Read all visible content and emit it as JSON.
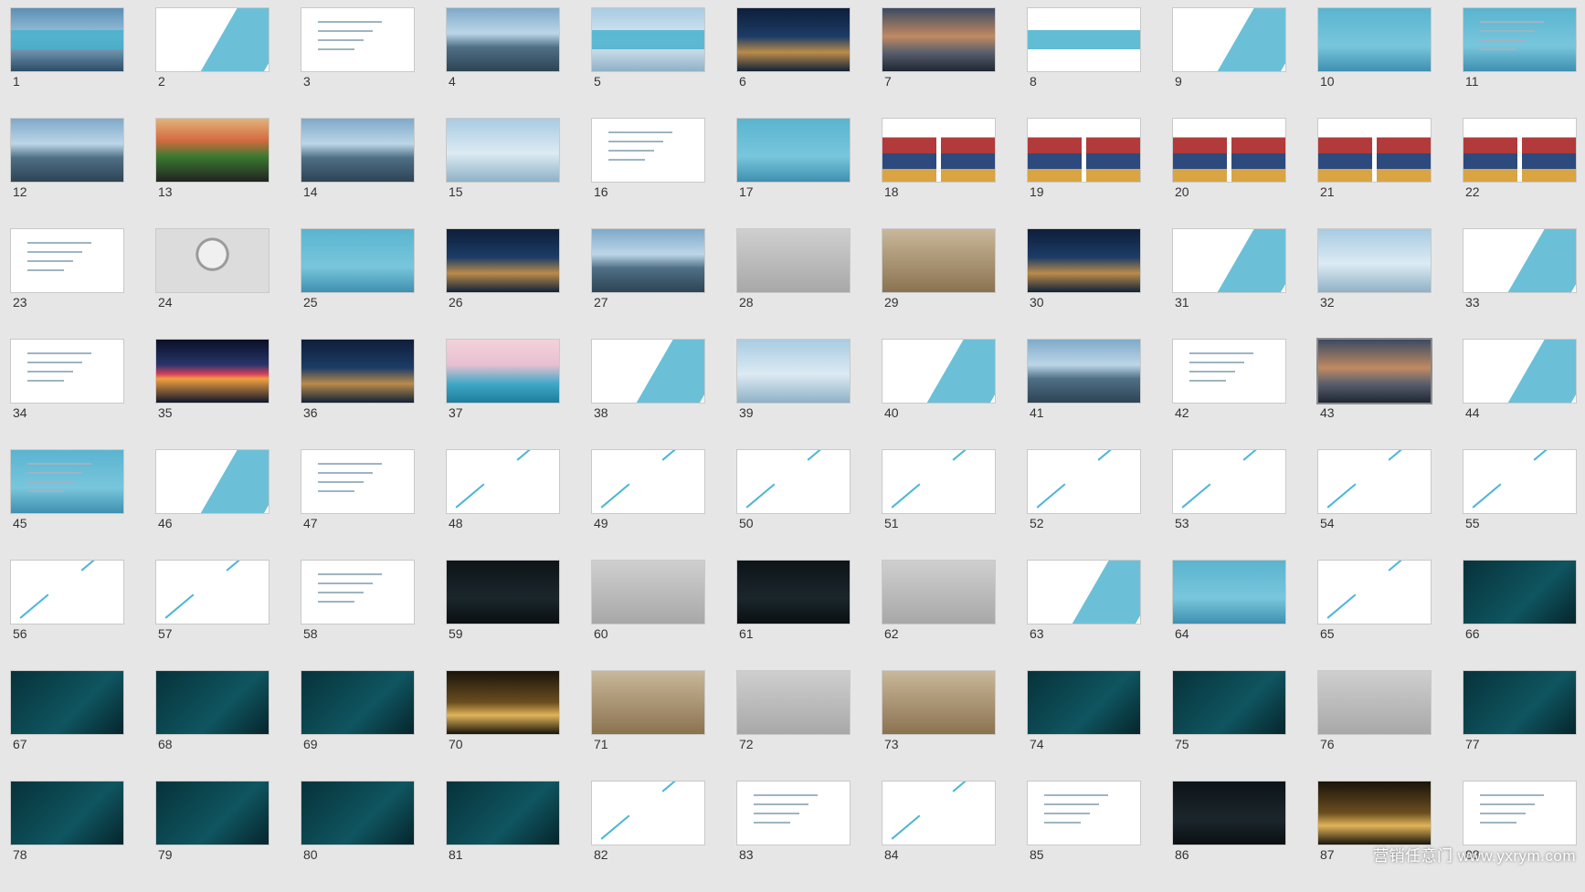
{
  "view": "slide-sorter",
  "accent_color": "#4bb6d6",
  "selected_slide": 43,
  "slides": [
    {
      "num": "1",
      "style": "photo-blue",
      "deco": "band"
    },
    {
      "num": "2",
      "style": "white",
      "deco": "diag"
    },
    {
      "num": "3",
      "style": "white",
      "deco": "lines"
    },
    {
      "num": "4",
      "style": "city",
      "deco": "none"
    },
    {
      "num": "5",
      "style": "sky",
      "deco": "band"
    },
    {
      "num": "6",
      "style": "night",
      "deco": "none"
    },
    {
      "num": "7",
      "style": "dusk",
      "deco": "none"
    },
    {
      "num": "8",
      "style": "white",
      "deco": "band"
    },
    {
      "num": "9",
      "style": "white",
      "deco": "diag"
    },
    {
      "num": "10",
      "style": "teal",
      "deco": "none"
    },
    {
      "num": "11",
      "style": "teal",
      "deco": "lines"
    },
    {
      "num": "12",
      "style": "city",
      "deco": "none"
    },
    {
      "num": "13",
      "style": "road",
      "deco": "none"
    },
    {
      "num": "14",
      "style": "city",
      "deco": "none"
    },
    {
      "num": "15",
      "style": "sky",
      "deco": "none"
    },
    {
      "num": "16",
      "style": "white",
      "deco": "lines"
    },
    {
      "num": "17",
      "style": "teal",
      "deco": "none"
    },
    {
      "num": "18",
      "style": "collage",
      "deco": "none"
    },
    {
      "num": "19",
      "style": "collage",
      "deco": "none"
    },
    {
      "num": "20",
      "style": "collage",
      "deco": "none"
    },
    {
      "num": "21",
      "style": "collage",
      "deco": "none"
    },
    {
      "num": "22",
      "style": "collage",
      "deco": "none"
    },
    {
      "num": "23",
      "style": "white",
      "deco": "lines"
    },
    {
      "num": "24",
      "style": "spheres",
      "deco": "none"
    },
    {
      "num": "25",
      "style": "teal",
      "deco": "none"
    },
    {
      "num": "26",
      "style": "night",
      "deco": "none"
    },
    {
      "num": "27",
      "style": "city",
      "deco": "none"
    },
    {
      "num": "28",
      "style": "gray",
      "deco": "none"
    },
    {
      "num": "29",
      "style": "wood",
      "deco": "none"
    },
    {
      "num": "30",
      "style": "night",
      "deco": "none"
    },
    {
      "num": "31",
      "style": "white",
      "deco": "diag"
    },
    {
      "num": "32",
      "style": "sky",
      "deco": "none"
    },
    {
      "num": "33",
      "style": "white",
      "deco": "diag"
    },
    {
      "num": "34",
      "style": "white",
      "deco": "lines"
    },
    {
      "num": "35",
      "style": "bridge",
      "deco": "none"
    },
    {
      "num": "36",
      "style": "night",
      "deco": "none"
    },
    {
      "num": "37",
      "style": "mountain",
      "deco": "none"
    },
    {
      "num": "38",
      "style": "white",
      "deco": "diag"
    },
    {
      "num": "39",
      "style": "sky",
      "deco": "none"
    },
    {
      "num": "40",
      "style": "white",
      "deco": "diag"
    },
    {
      "num": "41",
      "style": "city",
      "deco": "none"
    },
    {
      "num": "42",
      "style": "white",
      "deco": "lines"
    },
    {
      "num": "43",
      "style": "dusk",
      "deco": "none"
    },
    {
      "num": "44",
      "style": "white",
      "deco": "diag"
    },
    {
      "num": "45",
      "style": "teal",
      "deco": "lines"
    },
    {
      "num": "46",
      "style": "white",
      "deco": "diag"
    },
    {
      "num": "47",
      "style": "white",
      "deco": "lines"
    },
    {
      "num": "48",
      "style": "white",
      "deco": "diagline"
    },
    {
      "num": "49",
      "style": "white",
      "deco": "diagline"
    },
    {
      "num": "50",
      "style": "white",
      "deco": "diagline"
    },
    {
      "num": "51",
      "style": "white",
      "deco": "diagline"
    },
    {
      "num": "52",
      "style": "white",
      "deco": "diagline"
    },
    {
      "num": "53",
      "style": "white",
      "deco": "diagline"
    },
    {
      "num": "54",
      "style": "white",
      "deco": "diagline"
    },
    {
      "num": "55",
      "style": "white",
      "deco": "diagline"
    },
    {
      "num": "56",
      "style": "white",
      "deco": "diagline"
    },
    {
      "num": "57",
      "style": "white",
      "deco": "diagline"
    },
    {
      "num": "58",
      "style": "white",
      "deco": "lines"
    },
    {
      "num": "59",
      "style": "dark",
      "deco": "none"
    },
    {
      "num": "60",
      "style": "gray",
      "deco": "none"
    },
    {
      "num": "61",
      "style": "dark",
      "deco": "none"
    },
    {
      "num": "62",
      "style": "gray",
      "deco": "none"
    },
    {
      "num": "63",
      "style": "white",
      "deco": "diag"
    },
    {
      "num": "64",
      "style": "teal",
      "deco": "none"
    },
    {
      "num": "65",
      "style": "white",
      "deco": "diagline"
    },
    {
      "num": "66",
      "style": "darkteal",
      "deco": "none"
    },
    {
      "num": "67",
      "style": "darkteal",
      "deco": "none"
    },
    {
      "num": "68",
      "style": "darkteal",
      "deco": "none"
    },
    {
      "num": "69",
      "style": "darkteal",
      "deco": "none"
    },
    {
      "num": "70",
      "style": "gold",
      "deco": "none"
    },
    {
      "num": "71",
      "style": "wood",
      "deco": "none"
    },
    {
      "num": "72",
      "style": "gray",
      "deco": "none"
    },
    {
      "num": "73",
      "style": "wood",
      "deco": "none"
    },
    {
      "num": "74",
      "style": "darkteal",
      "deco": "none"
    },
    {
      "num": "75",
      "style": "darkteal",
      "deco": "none"
    },
    {
      "num": "76",
      "style": "gray",
      "deco": "none"
    },
    {
      "num": "77",
      "style": "darkteal",
      "deco": "none"
    },
    {
      "num": "78",
      "style": "darkteal",
      "deco": "none"
    },
    {
      "num": "79",
      "style": "darkteal",
      "deco": "none"
    },
    {
      "num": "80",
      "style": "darkteal",
      "deco": "none"
    },
    {
      "num": "81",
      "style": "darkteal",
      "deco": "none"
    },
    {
      "num": "82",
      "style": "white",
      "deco": "diagline"
    },
    {
      "num": "83",
      "style": "white",
      "deco": "lines"
    },
    {
      "num": "84",
      "style": "white",
      "deco": "diagline"
    },
    {
      "num": "85",
      "style": "white",
      "deco": "lines"
    },
    {
      "num": "86",
      "style": "dark",
      "deco": "none"
    },
    {
      "num": "87",
      "style": "gold",
      "deco": "none"
    },
    {
      "num": "88",
      "style": "white",
      "deco": "lines"
    }
  ],
  "watermark": "营销任意门 www.yxrym.com"
}
